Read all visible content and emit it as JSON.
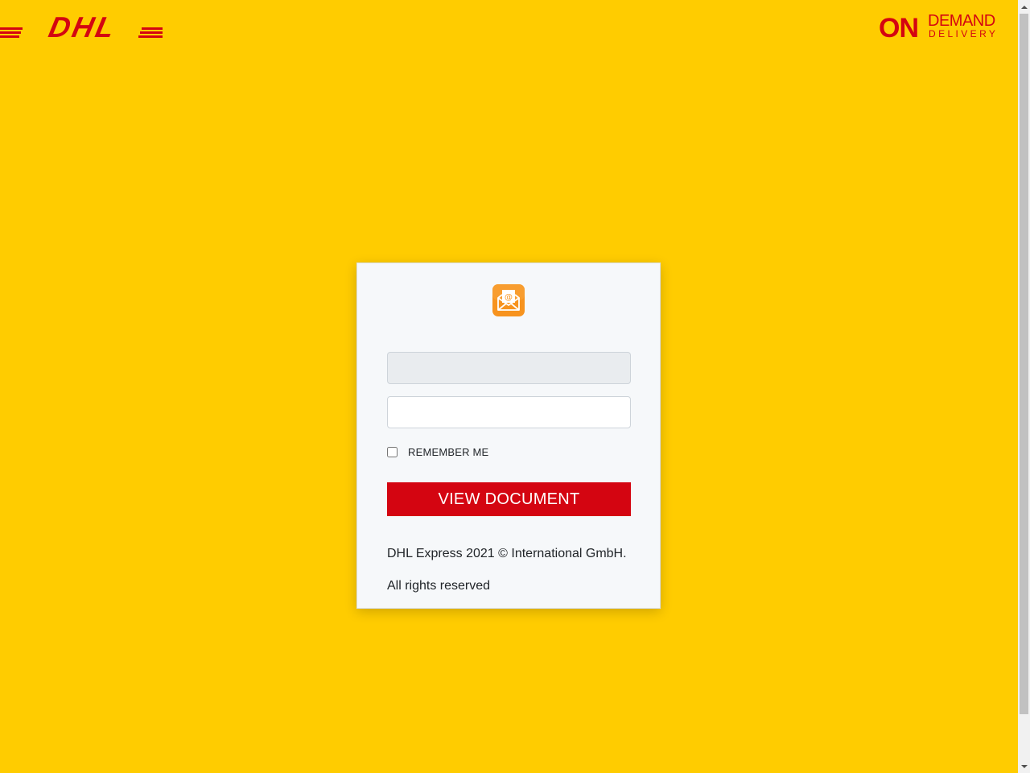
{
  "brand": {
    "logo_text": "DHL",
    "partner_logo_on": "ON",
    "partner_logo_demand": "DEMAND",
    "partner_logo_delivery": "DELIVERY",
    "colors": {
      "background": "#ffcc00",
      "brand_red": "#d40511",
      "card": "#f6f8fa",
      "icon_orange": "#f7931e"
    }
  },
  "login": {
    "icon": "open-envelope-at-icon",
    "email": {
      "value": "",
      "placeholder": ""
    },
    "password": {
      "value": "",
      "placeholder": ""
    },
    "remember_label": "REMEMBER ME",
    "remember_checked": false,
    "submit_label": "VIEW DOCUMENT"
  },
  "footer": {
    "copyright": "DHL Express 2021 © International GmbH.",
    "rights": "All rights reserved"
  }
}
